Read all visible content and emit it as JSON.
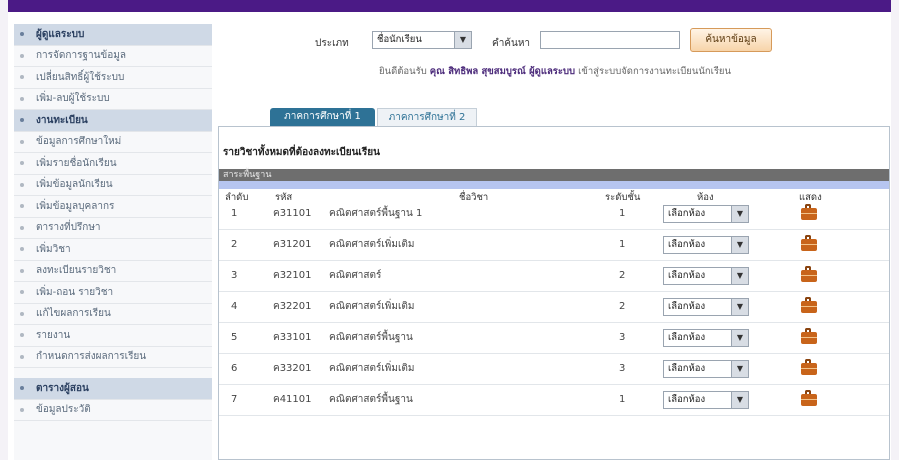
{
  "sidebar": {
    "group1": [
      {
        "label": "ผู้ดูแลระบบ",
        "header": true
      },
      {
        "label": "การจัดการฐานข้อมูล"
      },
      {
        "label": "เปลี่ยนสิทธิ์ผู้ใช้ระบบ"
      },
      {
        "label": "เพิ่ม-ลบผู้ใช้ระบบ"
      },
      {
        "label": "งานทะเบียน",
        "header": true
      },
      {
        "label": "ข้อมูลการศึกษาใหม่"
      },
      {
        "label": "เพิ่มรายชื่อนักเรียน"
      },
      {
        "label": "เพิ่มข้อมูลนักเรียน"
      },
      {
        "label": "เพิ่มข้อมูลบุคลากร"
      },
      {
        "label": "ตารางที่ปรึกษา"
      },
      {
        "label": "เพิ่มวิชา"
      },
      {
        "label": "ลงทะเบียนรายวิชา"
      },
      {
        "label": "เพิ่ม-ถอน รายวิชา"
      },
      {
        "label": "แก้ไขผลการเรียน"
      },
      {
        "label": "รายงาน"
      },
      {
        "label": "กำหนดการส่งผลการเรียน"
      }
    ],
    "group2": [
      {
        "label": "ตารางผู้สอน",
        "header": true
      },
      {
        "label": "ข้อมูลประวัติ"
      }
    ]
  },
  "search": {
    "type_label": "ประเภท",
    "type_value": "ชื่อนักเรียน",
    "keyword_label": "คำค้นหา",
    "keyword_value": "",
    "button_label": "ค้นหาข้อมูล"
  },
  "welcome": {
    "prefix": "ยินดีต้อนรับ",
    "name": "คุณ สิทธิพล สุขสมบูรณ์ ผู้ดูแลระบบ",
    "suffix": "เข้าสู่ระบบจัดการงานทะเบียนนักเรียน"
  },
  "tabs": [
    {
      "label": "ภาคการศึกษาที่ 1",
      "active": true
    },
    {
      "label": "ภาคการศึกษาที่ 2",
      "active": false
    }
  ],
  "panel": {
    "title": "รายวิชาทั้งหมดที่ต้องลงทะเบียนเรียน",
    "section": "สาระพื้นฐาน"
  },
  "table": {
    "headers": [
      "ลำดับ",
      "รหัส",
      "ชื่อวิชา",
      "ระดับชั้น",
      "ห้อง",
      "แสดง"
    ],
    "rows": [
      {
        "no": "1",
        "code": "ค31101",
        "name": "คณิตศาสตร์พื้นฐาน 1",
        "level": "1",
        "room": "เลือกห้อง"
      },
      {
        "no": "2",
        "code": "ค31201",
        "name": "คณิตศาสตร์เพิ่มเติม",
        "level": "1",
        "room": "เลือกห้อง"
      },
      {
        "no": "3",
        "code": "ค32101",
        "name": "คณิตศาสตร์",
        "level": "2",
        "room": "เลือกห้อง"
      },
      {
        "no": "4",
        "code": "ค32201",
        "name": "คณิตศาสตร์เพิ่มเติม",
        "level": "2",
        "room": "เลือกห้อง"
      },
      {
        "no": "5",
        "code": "ค33101",
        "name": "คณิตศาสตร์พื้นฐาน",
        "level": "3",
        "room": "เลือกห้อง"
      },
      {
        "no": "6",
        "code": "ค33201",
        "name": "คณิตศาสตร์เพิ่มเติม",
        "level": "3",
        "room": "เลือกห้อง"
      },
      {
        "no": "7",
        "code": "ค41101",
        "name": "คณิตศาสตร์พื้นฐาน",
        "level": "1",
        "room": "เลือกห้อง"
      }
    ]
  },
  "colors": {
    "frame": "#4b1a86",
    "tab_active": "#2e7296",
    "section_bar": "#6e6e6e",
    "accent_strip": "#b6c5f0",
    "button": "#f7d4a9"
  },
  "icons": {
    "dropdown": "chevron-down-icon",
    "show": "briefcase-icon"
  }
}
